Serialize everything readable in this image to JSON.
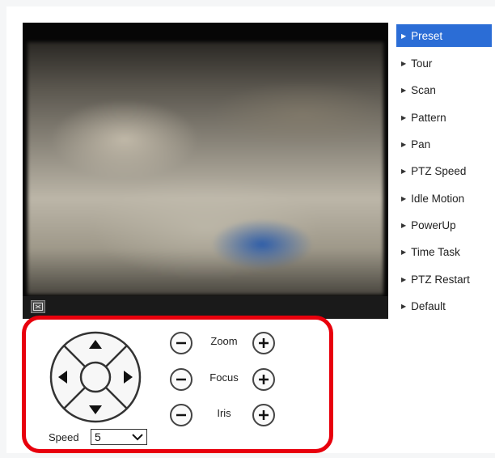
{
  "menu": {
    "items": [
      {
        "label": "Preset",
        "active": true
      },
      {
        "label": "Tour"
      },
      {
        "label": "Scan"
      },
      {
        "label": "Pattern"
      },
      {
        "label": "Pan"
      },
      {
        "label": "PTZ Speed"
      },
      {
        "label": "Idle Motion"
      },
      {
        "label": "PowerUp"
      },
      {
        "label": "Time Task"
      },
      {
        "label": "PTZ Restart"
      },
      {
        "label": "Default"
      }
    ]
  },
  "controls": {
    "zoom_label": "Zoom",
    "focus_label": "Focus",
    "iris_label": "Iris",
    "speed_label": "Speed",
    "speed_value": "5"
  },
  "colors": {
    "accent": "#2b6dd6",
    "highlight": "#e8000c"
  },
  "icons": {
    "fullscreen": "fullscreen-icon",
    "minus": "minus-icon",
    "plus": "plus-icon",
    "dropdown": "chevron-down-icon"
  }
}
